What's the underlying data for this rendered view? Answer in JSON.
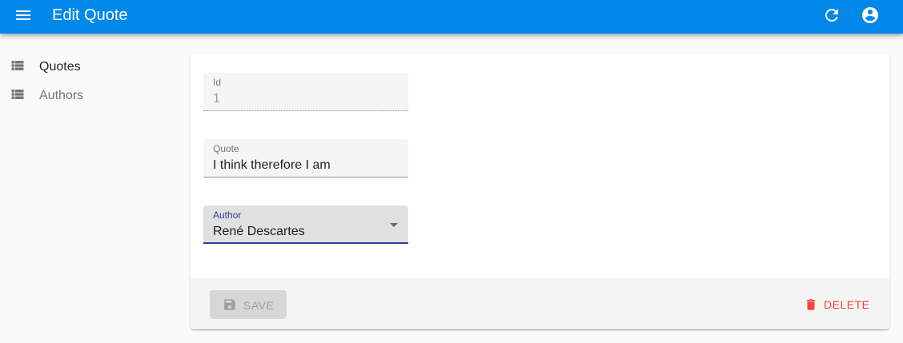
{
  "appbar": {
    "title": "Edit Quote",
    "menu_icon": "menu-icon",
    "refresh_icon": "refresh-icon",
    "account_icon": "account-circle-icon",
    "color": "#0288e8"
  },
  "sidebar": {
    "items": [
      {
        "label": "Quotes",
        "icon": "list-icon",
        "active": true
      },
      {
        "label": "Authors",
        "icon": "list-icon",
        "active": false
      }
    ]
  },
  "form": {
    "id": {
      "label": "Id",
      "value": "1",
      "disabled": true
    },
    "quote": {
      "label": "Quote",
      "value": "I think therefore I am"
    },
    "author": {
      "label": "Author",
      "value": "René Descartes",
      "accent": "#303f9f"
    }
  },
  "toolbar": {
    "save_label": "SAVE",
    "save_disabled": true,
    "delete_label": "DELETE",
    "delete_color": "#f44336"
  }
}
